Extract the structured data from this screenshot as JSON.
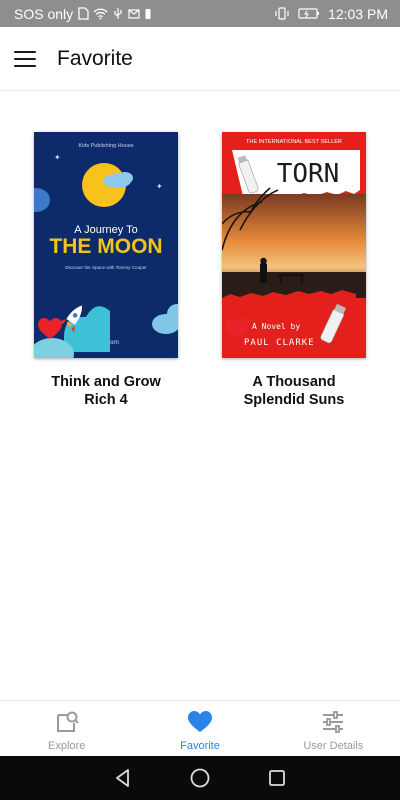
{
  "status_bar": {
    "carrier": "SOS only",
    "time": "12:03 PM"
  },
  "header": {
    "title": "Favorite"
  },
  "books": [
    {
      "title": "Think and Grow Rich 4",
      "cover": {
        "publisher": "Kids Publishing House",
        "line1": "A Journey To",
        "line2": "THE MOON",
        "tagline": "Discover the Space with Tommy Cooper",
        "author": "Max Born",
        "bg_color": "#0d2b6b",
        "accent_color": "#f2c31b"
      },
      "favorite": true
    },
    {
      "title": "A Thousand Splendid Suns",
      "cover": {
        "banner": "THE INTERNATIONAL BEST SELLER",
        "headline": "TORN",
        "subline": "A Novel by",
        "author": "PAUL CLARKE",
        "accent_color": "#e3201b"
      },
      "favorite": true
    }
  ],
  "bottom_nav": {
    "items": [
      {
        "label": "Explore",
        "icon": "explore-icon",
        "active": false
      },
      {
        "label": "Favorite",
        "icon": "heart-icon",
        "active": true
      },
      {
        "label": "User Details",
        "icon": "sliders-icon",
        "active": false
      }
    ],
    "active_color": "#2b82e8",
    "inactive_color": "#9a9a9a"
  },
  "heart_color": "#e8232a"
}
